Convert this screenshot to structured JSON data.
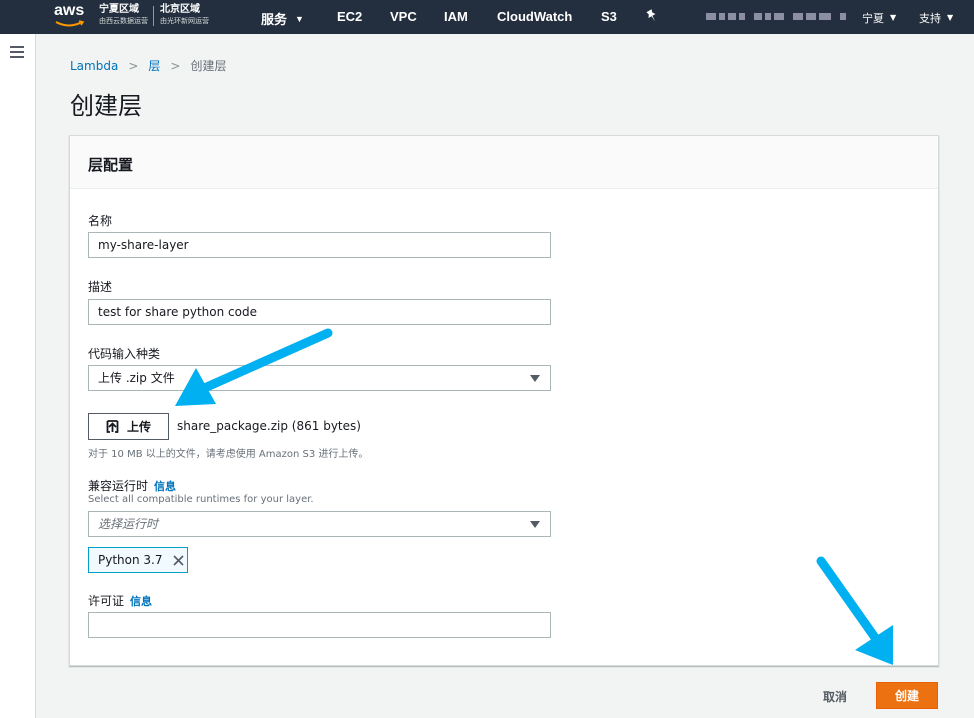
{
  "nav": {
    "logo": "aws",
    "region1_name": "宁夏区域",
    "region1_sub": "由西云数据运营",
    "region2_name": "北京区域",
    "region2_sub": "由光环新网运营",
    "services": "服务",
    "items": [
      "EC2",
      "VPC",
      "IAM",
      "CloudWatch",
      "S3"
    ],
    "region_select": "宁夏",
    "support": "支持"
  },
  "breadcrumb": {
    "items": [
      "Lambda",
      "层"
    ],
    "current": "创建层"
  },
  "page_title": "创建层",
  "panel": {
    "title": "层配置",
    "name": {
      "label": "名称",
      "value": "my-share-layer"
    },
    "description": {
      "label": "描述",
      "value": "test for share python code"
    },
    "code_entry": {
      "label": "代码输入种类",
      "selected": "上传 .zip 文件"
    },
    "upload": {
      "button_label": "上传",
      "file_name": "share_package.zip (861 bytes)",
      "hint": "对于 10 MB 以上的文件，请考虑使用 Amazon S3 进行上传。"
    },
    "runtimes": {
      "label": "兼容运行时",
      "info": "信息",
      "description": "Select all compatible runtimes for your layer.",
      "placeholder": "选择运行时",
      "tokens": [
        "Python 3.7"
      ]
    },
    "license": {
      "label": "许可证",
      "info": "信息",
      "value": ""
    }
  },
  "footer": {
    "cancel_label": "取消",
    "create_label": "创建"
  },
  "colors": {
    "nav_bg": "#232f3e",
    "link": "#0073bb",
    "primary_button": "#ec7211",
    "token_border": "#00a1c9",
    "annotation_arrow": "#00b0f0"
  }
}
